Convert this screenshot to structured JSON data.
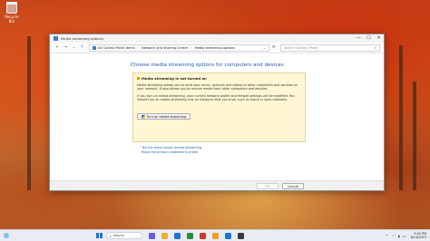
{
  "desktop": {
    "recycle_bin_label": "Recycle Bin"
  },
  "window": {
    "title": "Media streaming options",
    "controls": {
      "minimize": "—",
      "maximize": "☐",
      "close": "✕"
    },
    "nav": {
      "back": "←",
      "forward": "→",
      "recent": "⌄",
      "up": "↑",
      "refresh": "⟳",
      "dropdown": "⌄"
    },
    "breadcrumbs": [
      "All Control Panel Items",
      "Network and Sharing Center",
      "Media streaming options"
    ],
    "search_placeholder": "Search Control Panel",
    "heading": "Choose media streaming options for computers and devices",
    "infobox": {
      "title": "Media streaming is not turned on",
      "paragraph1": "Media streaming allows you to send your music, pictures and videos to other computers and devices on your network. It also allows you to receive media from other computers and devices.",
      "paragraph2": "If you turn on media streaming, your current network profile and firewall settings will be modified. You should turn on media streaming only on networks that you trust, such as home or work networks.",
      "button": "Turn on media streaming"
    },
    "links": [
      "Tell me more about media streaming",
      "Read the privacy statement online"
    ],
    "footer": {
      "ok": "OK",
      "cancel": "Cancel"
    }
  },
  "taskbar": {
    "search_label": "Search",
    "tray_chevron": "^",
    "tray_icons": [
      "wifi-icon",
      "volume-icon",
      "battery-icon"
    ],
    "time": "5:52 PM",
    "date": "8/14/2023",
    "pinned_colors": [
      "#6b5bd6",
      "#e8b030",
      "#1d74d8",
      "#2b8a3e",
      "#d03a2a",
      "#f0a020",
      "#1d74d8",
      "#3a3a3a"
    ]
  },
  "colors": {
    "accent": "#1d74d8",
    "link": "#1e5aa8",
    "info_background": "#fff6d4"
  }
}
